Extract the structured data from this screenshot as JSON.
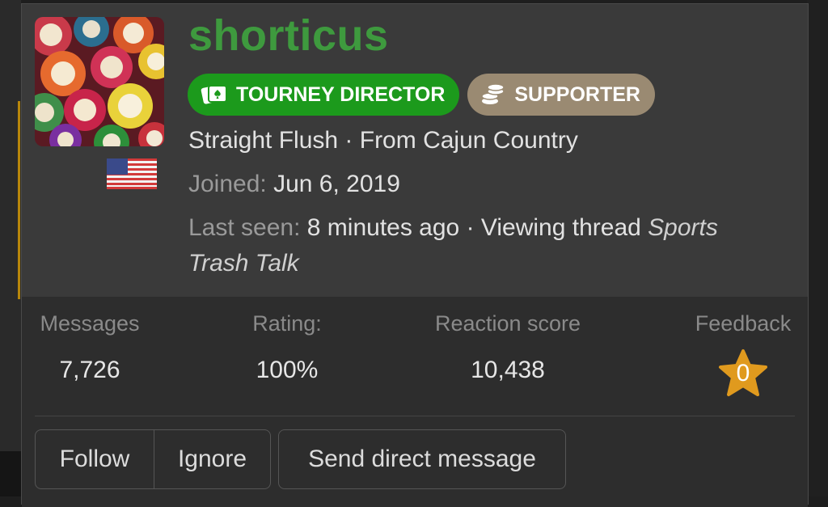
{
  "profile": {
    "username": "shorticus",
    "avatar_icon": "poker-chips-avatar",
    "flag_icon": "us-flag-icon",
    "badges": [
      {
        "label": "TOURNEY DIRECTOR",
        "icon": "cards-icon",
        "color": "#1c9a1c"
      },
      {
        "label": "SUPPORTER",
        "icon": "chip-stack-icon",
        "color": "#9a8a72"
      }
    ],
    "title_line": "Straight Flush · From Cajun Country",
    "joined_label": "Joined:",
    "joined_value": "Jun 6, 2019",
    "last_seen_label": "Last seen:",
    "last_seen_value": "8 minutes ago · Viewing thread ",
    "thread_title_part1": "Sports",
    "thread_title_part2": "Trash Talk"
  },
  "stats": [
    {
      "label": "Messages",
      "value": "7,726"
    },
    {
      "label": "Rating:",
      "value": "100%"
    },
    {
      "label": "Reaction score",
      "value": "10,438"
    },
    {
      "label": "Feedback",
      "value": "0"
    }
  ],
  "actions": {
    "follow": "Follow",
    "ignore": "Ignore",
    "message": "Send direct message"
  },
  "colors": {
    "username": "#3e9a3e",
    "feedback_star": "#e09a1e"
  }
}
